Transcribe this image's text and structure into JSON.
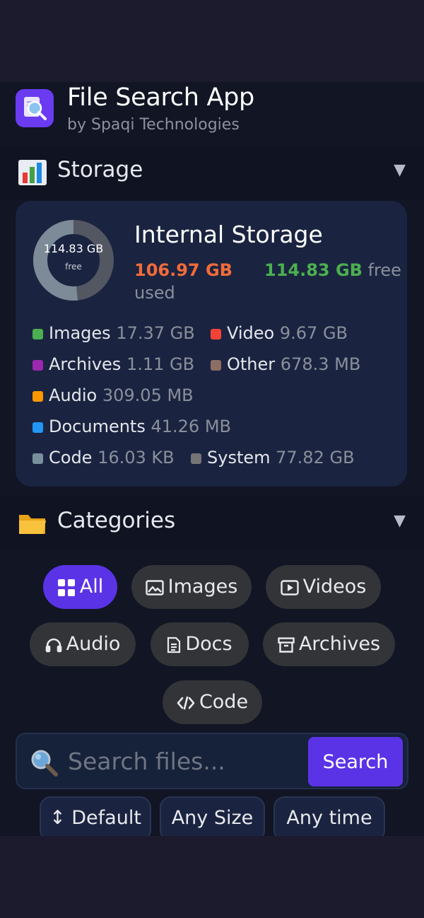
{
  "header": {
    "title": "File Search App",
    "subtitle": "by Spaqi Technologies"
  },
  "sections": {
    "storage": {
      "title": "Storage",
      "toggle": "▼"
    },
    "categories": {
      "title": "Categories",
      "toggle": "▼"
    }
  },
  "storage": {
    "title": "Internal Storage",
    "used_value": "106.97 GB",
    "used_label": "used",
    "free_value": "114.83 GB",
    "free_label": "free",
    "donut_value": "114.83 GB",
    "donut_label": "free",
    "used_fraction": 0.482,
    "colors": {
      "used": "#f26b3a",
      "free": "#4caf50",
      "ring_track": "#535762",
      "ring_free": "#7d8a98"
    },
    "legend": [
      {
        "name": "Images",
        "size": "17.37 GB",
        "color": "#4caf50"
      },
      {
        "name": "Video",
        "size": "9.67 GB",
        "color": "#f44336"
      },
      {
        "name": "Archives",
        "size": "1.11 GB",
        "color": "#9c27b0"
      },
      {
        "name": "Other",
        "size": "678.3 MB",
        "color": "#8d6e63"
      },
      {
        "name": "Audio",
        "size": "309.05 MB",
        "color": "#ff9800"
      },
      {
        "name": "Documents",
        "size": "41.26 MB",
        "color": "#2196f3"
      },
      {
        "name": "Code",
        "size": "16.03 KB",
        "color": "#78909c"
      },
      {
        "name": "System",
        "size": "77.82 GB",
        "color": "#757575"
      }
    ]
  },
  "categories": [
    {
      "label": "All",
      "icon": "grid-icon",
      "active": true
    },
    {
      "label": "Images",
      "icon": "image-icon",
      "active": false
    },
    {
      "label": "Videos",
      "icon": "play-icon",
      "active": false
    },
    {
      "label": "Audio",
      "icon": "headphones-icon",
      "active": false
    },
    {
      "label": "Docs",
      "icon": "document-icon",
      "active": false
    },
    {
      "label": "Archives",
      "icon": "archive-icon",
      "active": false
    },
    {
      "label": "Code",
      "icon": "code-icon",
      "active": false
    }
  ],
  "search": {
    "placeholder": "Search files...",
    "value": "",
    "button_label": "Search"
  },
  "filters": {
    "sort": "↕ Default",
    "size": "Any Size",
    "time": "Any time"
  },
  "theme": {
    "accent": "#5b33e6",
    "chip": "#333438",
    "card": "#1a2440"
  }
}
